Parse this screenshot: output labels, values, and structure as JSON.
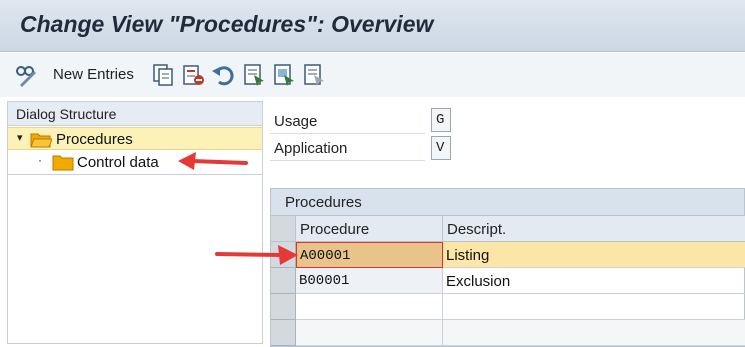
{
  "window": {
    "title": "Change View \"Procedures\": Overview"
  },
  "toolbar": {
    "new_entries_label": "New Entries",
    "icons": [
      "display-change-icon",
      "copy-icon",
      "delete-icon",
      "undo-icon",
      "select-all-icon",
      "select-block-icon",
      "deselect-all-icon"
    ]
  },
  "dialog_structure": {
    "header": "Dialog Structure",
    "items": [
      {
        "label": "Procedures",
        "selected": true,
        "expanded": true
      },
      {
        "label": "Control data",
        "selected": false
      }
    ]
  },
  "fields": {
    "usage": {
      "label": "Usage",
      "value": "G"
    },
    "application": {
      "label": "Application",
      "value": "V"
    }
  },
  "table": {
    "title": "Procedures",
    "columns": [
      "Procedure",
      "Descript."
    ],
    "rows": [
      {
        "procedure": "A00001",
        "description": "Listing",
        "highlighted": true
      },
      {
        "procedure": "B00001",
        "description": "Exclusion",
        "highlighted": false
      }
    ]
  },
  "colors": {
    "title_bg": "#cbd7e4",
    "highlight": "#fbe6a7",
    "tree_selected": "#fcf1b6",
    "annotation_arrow": "#e53935"
  }
}
